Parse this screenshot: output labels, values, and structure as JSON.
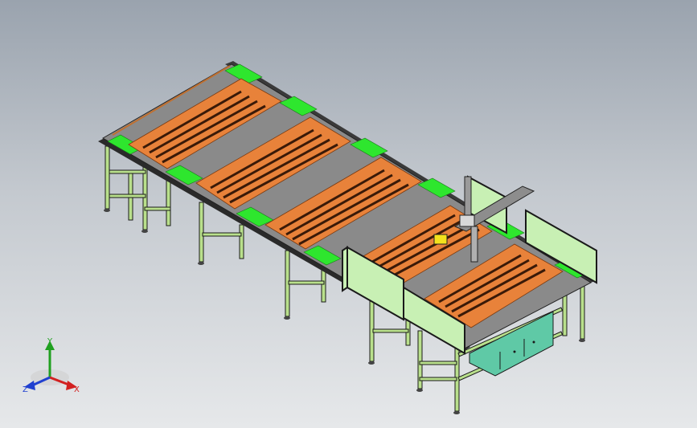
{
  "viewport": {
    "background_top": "#9aa3ae",
    "background_bottom": "#e6e8ea"
  },
  "colors": {
    "frame_green": "#b9e08c",
    "frame_dark": "#1a1a1a",
    "tray_orange": "#e8823a",
    "belt_green": "#2ee62e",
    "panel_green": "#c8f0b4",
    "cabinet_teal": "#5fc9a6",
    "gantry_gray": "#8d8d8d",
    "sensor_yellow": "#f3e21c"
  },
  "triad": {
    "x_label": "X",
    "y_label": "Y",
    "z_label": "Z",
    "x_color": "#d22020",
    "y_color": "#20a020",
    "z_color": "#2040d0"
  }
}
